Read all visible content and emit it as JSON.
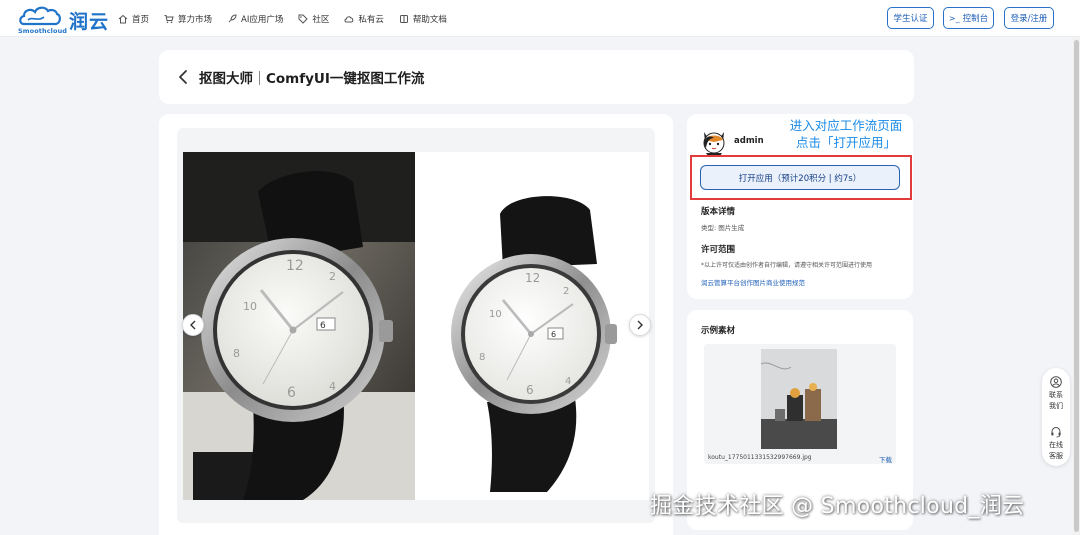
{
  "brand": {
    "logo_sub": "Smoothcloud",
    "name": "润云"
  },
  "nav": {
    "items": [
      {
        "label": "首页",
        "icon": "home-icon"
      },
      {
        "label": "算力市场",
        "icon": "cart-icon"
      },
      {
        "label": "AI应用广场",
        "icon": "rocket-icon"
      },
      {
        "label": "社区",
        "icon": "tag-icon"
      },
      {
        "label": "私有云",
        "icon": "cloud-icon"
      },
      {
        "label": "帮助文档",
        "icon": "book-icon"
      }
    ],
    "student_auth": "学生认证",
    "console": "控制台",
    "login": "登录/注册"
  },
  "header": {
    "title_part1": "抠图大师",
    "title_part2": "ComfyUI一键抠图工作流"
  },
  "author": {
    "name": "admin"
  },
  "annotation": {
    "line1": "进入对应工作流页面",
    "line2": "点击「打开应用」"
  },
  "open_button": "打开应用（预计20积分 | 约7s）",
  "version": {
    "heading": "版本详情",
    "type_text": "类型: 图片生成"
  },
  "license": {
    "heading": "许可范围",
    "note": "*以上许可仅适由创作者自行编辑，请遵守相关许可范围进行使用",
    "link": "润云管算平台创作图片商业使用规范"
  },
  "samples": {
    "heading": "示例素材",
    "filename": "koutu_1775011331532997669.jpg",
    "download": "下载"
  },
  "float": {
    "contact": [
      "联系",
      "我们"
    ],
    "service": [
      "在线",
      "客服"
    ]
  },
  "watermark": "掘金技术社区 @ Smoothcloud_润云",
  "colors": {
    "brand_blue": "#1f73c9",
    "link_blue": "#1f5fb8",
    "annotation_blue": "#1a8be8",
    "highlight_red": "#e23b3b"
  }
}
